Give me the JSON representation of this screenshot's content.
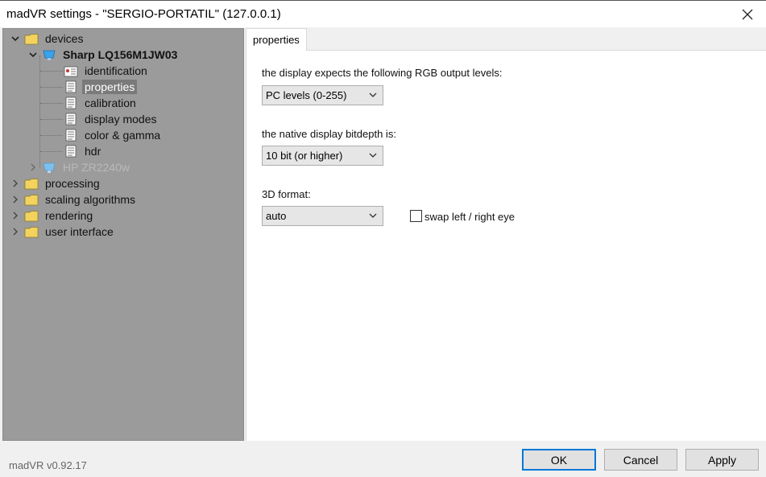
{
  "window": {
    "title": "madVR settings - \"SERGIO-PORTATIL\" (127.0.0.1)",
    "close_icon": "close-icon"
  },
  "tree": {
    "devices": "devices",
    "device1": "Sharp LQ156M1JW03",
    "identification": "identification",
    "properties": "properties",
    "calibration": "calibration",
    "display_modes": "display modes",
    "color_gamma": "color & gamma",
    "hdr": "hdr",
    "device2": "HP ZR2240w",
    "processing": "processing",
    "scaling": "scaling algorithms",
    "rendering": "rendering",
    "user_interface": "user interface"
  },
  "tab": {
    "label": "properties"
  },
  "form": {
    "rgb_label": "the display expects the following RGB output levels:",
    "rgb_value": "PC levels (0-255)",
    "bitdepth_label": "the native display bitdepth is:",
    "bitdepth_value": "10 bit (or higher)",
    "format3d_label": "3D format:",
    "format3d_value": "auto",
    "swap_label": "swap left / right eye",
    "swap_checked": false
  },
  "footer": {
    "version": "madVR v0.92.17",
    "ok": "OK",
    "cancel": "Cancel",
    "apply": "Apply"
  },
  "colors": {
    "tree_bg": "#9b9b9b",
    "selection": "#7a7a7a",
    "folder": "#f3d35e",
    "monitor": "#3aa2e8",
    "accent": "#0078d7"
  }
}
